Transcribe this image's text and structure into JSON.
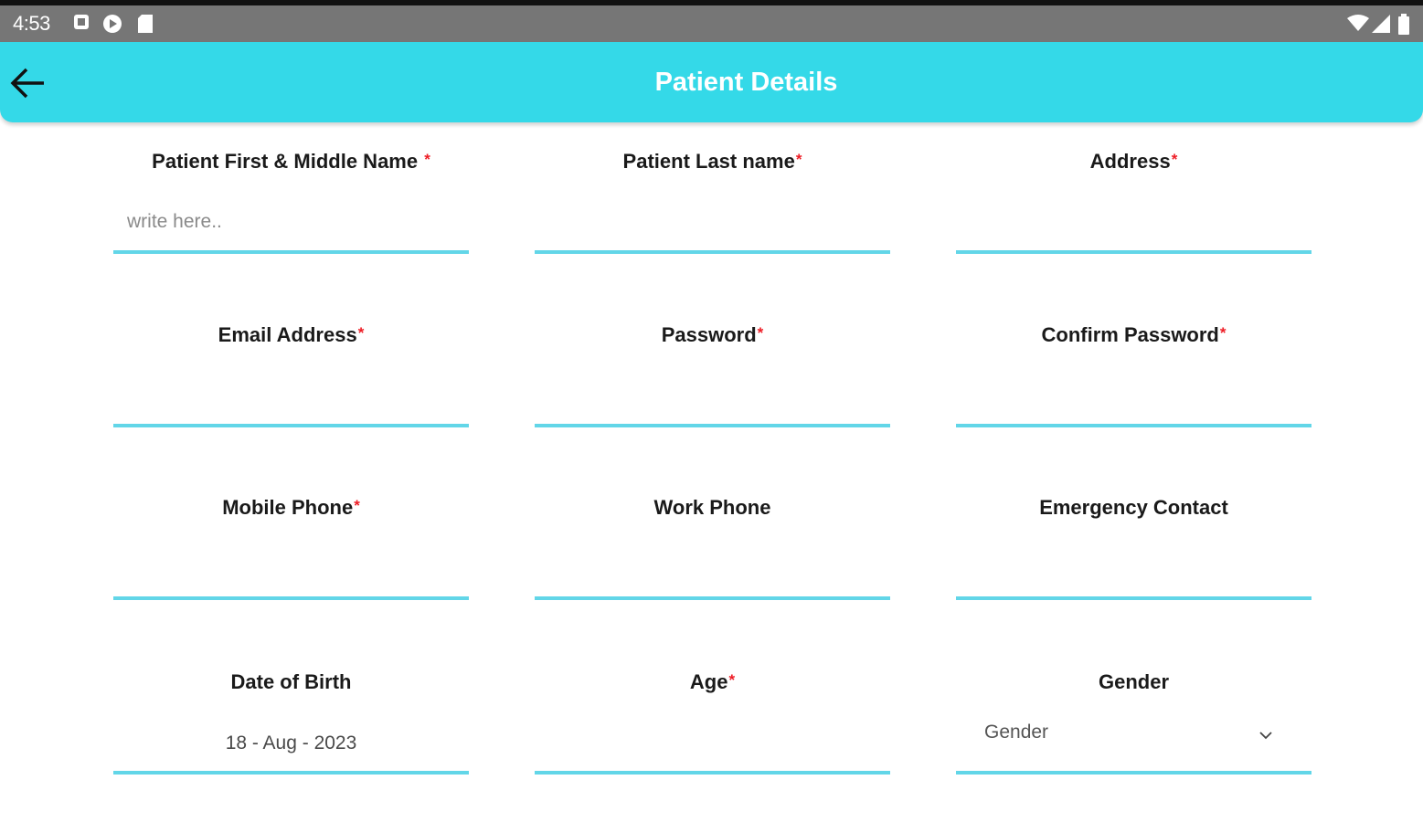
{
  "status_bar": {
    "time": "4:53",
    "left_icons": [
      "notification-square-icon",
      "play-store-icon",
      "sd-card-icon"
    ],
    "right_icons": [
      "wifi-icon",
      "signal-icon",
      "battery-icon"
    ]
  },
  "app_bar": {
    "title": "Patient Details",
    "back_icon": "arrow-left-icon",
    "color": "#34d9e8"
  },
  "colors": {
    "accent": "#34d9e8",
    "underline": "#62d6e8",
    "required_marker": "#ee1c25"
  },
  "form": {
    "required_marker": "*",
    "first_middle_name": {
      "label": "Patient First & Middle Name ",
      "placeholder": "write here..",
      "value": ""
    },
    "last_name": {
      "label": "Patient Last name",
      "value": ""
    },
    "address": {
      "label": "Address",
      "value": ""
    },
    "email": {
      "label": "Email Address",
      "value": ""
    },
    "password": {
      "label": "Password",
      "value": ""
    },
    "confirm_password": {
      "label": "Confirm Password",
      "value": ""
    },
    "mobile_phone": {
      "label": "Mobile Phone",
      "value": ""
    },
    "work_phone": {
      "label": "Work Phone",
      "value": ""
    },
    "emergency_contact": {
      "label": "Emergency Contact",
      "value": ""
    },
    "date_of_birth": {
      "label": "Date of Birth",
      "value": "18 - Aug - 2023"
    },
    "age": {
      "label": "Age",
      "value": ""
    },
    "gender": {
      "label": "Gender",
      "selected": "Gender",
      "icon": "chevron-down-icon"
    }
  }
}
